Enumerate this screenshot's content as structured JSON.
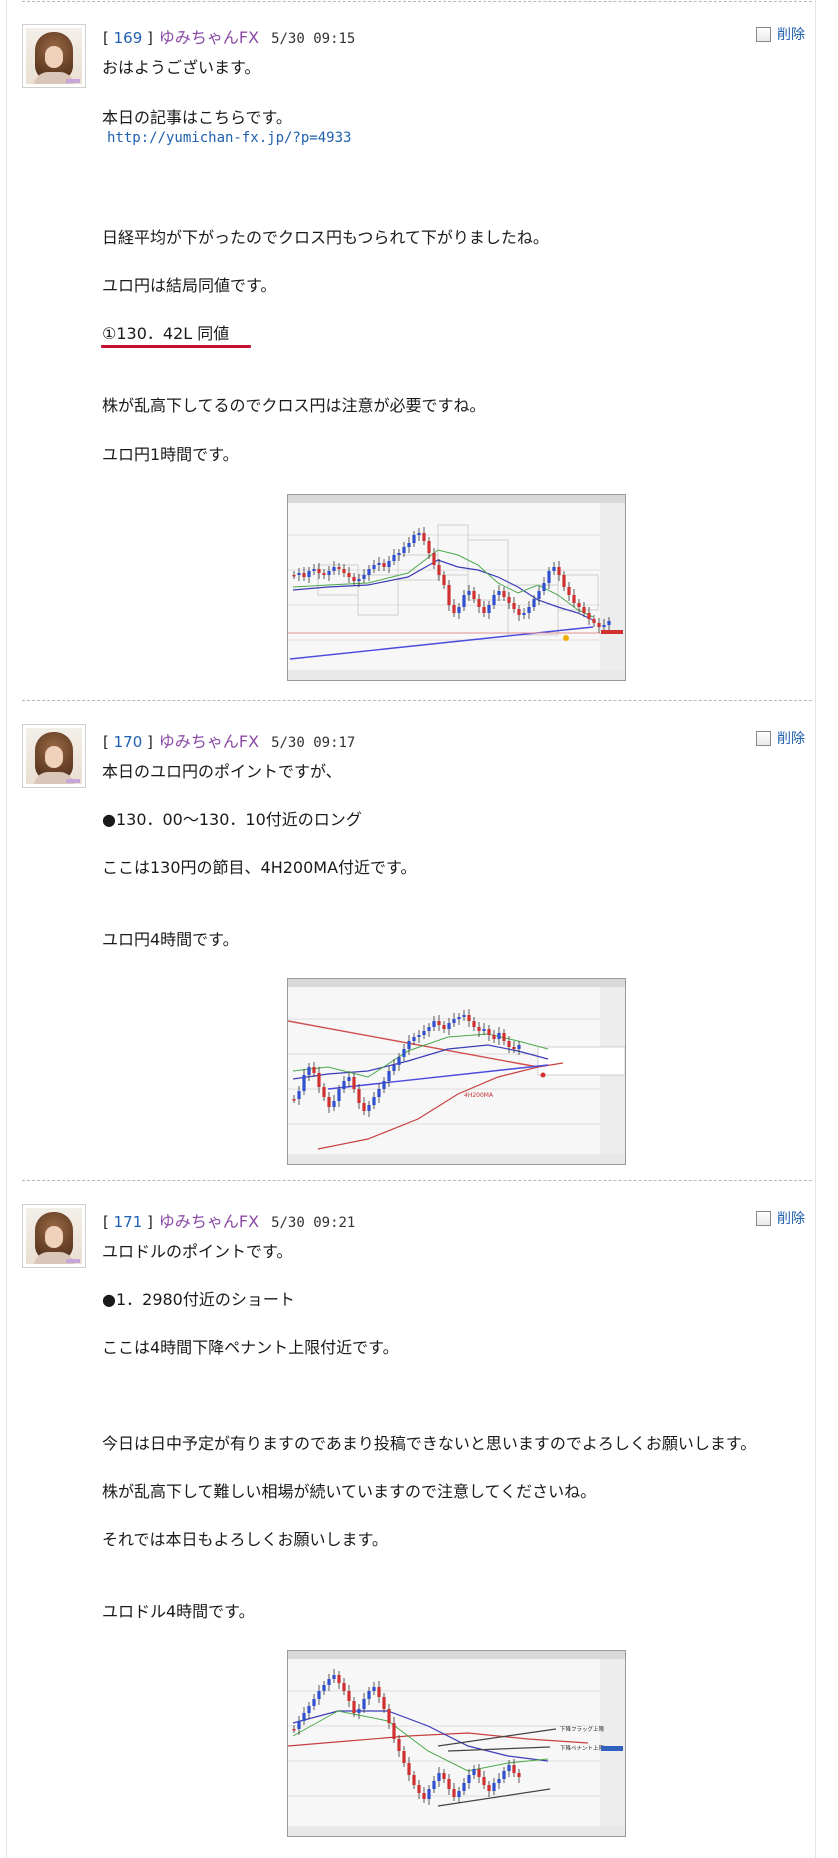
{
  "delete_label": "削除",
  "posts": [
    {
      "number": "169",
      "author": "ゆみちゃんFX",
      "date": "5/30 09:15",
      "lines": {
        "l1": "おはようございます。",
        "l2": "本日の記事はこちらです。",
        "link": "http://yumichan-fx.jp/?p=4933",
        "l3": "日経平均が下がったのでクロス円もつられて下がりましたね。",
        "l4": "ユロ円は結局同値です。",
        "l5": "①130．42L 同値",
        "l6": "株が乱高下してるのでクロス円は注意が必要ですね。",
        "l7": "ユロ円1時間です。"
      }
    },
    {
      "number": "170",
      "author": "ゆみちゃんFX",
      "date": "5/30 09:17",
      "lines": {
        "l1": "本日のユロ円のポイントですが、",
        "l2": "●130．00〜130．10付近のロング",
        "l3": "ここは130円の節目、4H200MA付近です。",
        "l4": "ユロ円4時間です。"
      },
      "chart_annotation": "4H200MA"
    },
    {
      "number": "171",
      "author": "ゆみちゃんFX",
      "date": "5/30 09:21",
      "lines": {
        "l1": "ユロドルのポイントです。",
        "l2": "●1．2980付近のショート",
        "l3": "ここは4時間下降ペナント上限付近です。",
        "l4": "今日は日中予定が有りますのであまり投稿できないと思いますのでよろしくお願いします。",
        "l5": "株が乱高下して難しい相場が続いていますので注意してくださいね。",
        "l6": "それでは本日もよろしくお願いします。",
        "l7": "ユロドル4時間です。"
      },
      "chart_annotations": {
        "upper": "下降フラッグ上限",
        "lower": "下降ペナント上限"
      }
    }
  ],
  "colors": {
    "number": "#2060b0",
    "author": "#8a4aa6",
    "underline": "#c8102e"
  }
}
